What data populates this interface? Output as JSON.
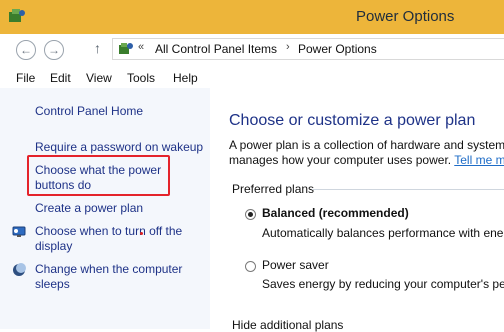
{
  "window": {
    "title": "Power Options",
    "title_bar_color": "#edb53a"
  },
  "navigation": {
    "back_glyph": "←",
    "forward_glyph": "→",
    "up_glyph": "↑",
    "icon": "control-panel-icon",
    "prefix": "«",
    "path": [
      "All Control Panel Items",
      "Power Options"
    ],
    "separator": "›"
  },
  "menu": {
    "items": [
      "File",
      "Edit",
      "View",
      "Tools",
      "Help"
    ]
  },
  "sidebar": {
    "home": "Control Panel Home",
    "links": [
      {
        "label": "Require a password on wakeup"
      },
      {
        "line1": "Choose what the power",
        "line2": "buttons do",
        "highlighted": true,
        "highlight_color": "#e4232b"
      },
      {
        "label": "Create a power plan"
      },
      {
        "line1": "Choose when to turn off the",
        "line2": "display",
        "icon": "monitor-icon"
      },
      {
        "line1": "Change when the computer",
        "line2": "sleeps",
        "icon": "moon-icon"
      }
    ]
  },
  "main": {
    "heading": "Choose or customize a power plan",
    "description_line1": "A power plan is a collection of hardware and system",
    "description_line2_prefix": "manages how your computer uses power.",
    "description_link": "Tell me m",
    "preferred_plans_label": "Preferred plans",
    "plans": [
      {
        "name": "Balanced (recommended)",
        "selected": true,
        "description": "Automatically balances performance with ene"
      },
      {
        "name": "Power saver",
        "selected": false,
        "description": "Saves energy by reducing your computer's pe"
      }
    ],
    "hide_label": "Hide additional plans"
  }
}
